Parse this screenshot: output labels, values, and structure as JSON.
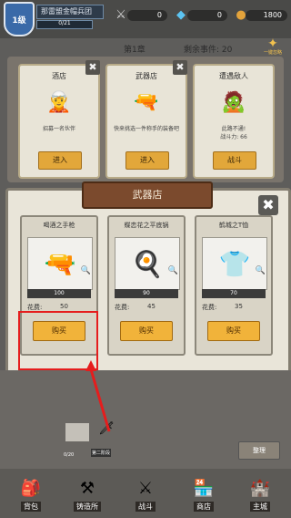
{
  "colors": {
    "accent": "#e2a73a",
    "highlight": "#e51d1d",
    "banner": "#7b4a2d"
  },
  "player": {
    "level": "1级",
    "name": "那雷盟金帽兵团",
    "xp_text": "0/21",
    "xp_progress": 0
  },
  "resources": {
    "attack": "0",
    "gems": "0",
    "gold": "1800"
  },
  "chapter": {
    "title": "第1章",
    "remaining": "剩余事件: 20",
    "dismiss_label": "一键忽略"
  },
  "events": [
    {
      "title": "酒店",
      "desc": "招募一名伙伴",
      "button": "进入",
      "icon": "recruit-hero-icon"
    },
    {
      "title": "武器店",
      "desc": "快来挑选一件称手的装备吧",
      "button": "进入",
      "icon": "weapon-shop-icon"
    },
    {
      "title": "遭遇敌人",
      "desc": "此路不通!",
      "power": "战斗力: 66",
      "button": "战斗",
      "icon": "enemy-icon"
    }
  ],
  "shop": {
    "title": "武器店",
    "cost_label": "花费:",
    "buy_label": "购买",
    "items": [
      {
        "name": "喝酒之手枪",
        "count": "100",
        "price": "50",
        "icon": "pistol-icon"
      },
      {
        "name": "蝶恋花之平底锅",
        "count": "90",
        "price": "45",
        "icon": "frying-pan-icon"
      },
      {
        "name": "鹤城之T恤",
        "count": "70",
        "price": "35",
        "icon": "tshirt-icon"
      }
    ]
  },
  "lower": {
    "arrange_label": "整理",
    "slot_label": "0/20",
    "weapon_label": "第二阶段"
  },
  "nav": [
    {
      "label": "背包",
      "icon": "backpack-icon"
    },
    {
      "label": "铸造所",
      "icon": "anvil-icon"
    },
    {
      "label": "战斗",
      "icon": "crossed-swords-icon"
    },
    {
      "label": "商店",
      "icon": "store-icon"
    },
    {
      "label": "主城",
      "icon": "castle-icon"
    }
  ]
}
